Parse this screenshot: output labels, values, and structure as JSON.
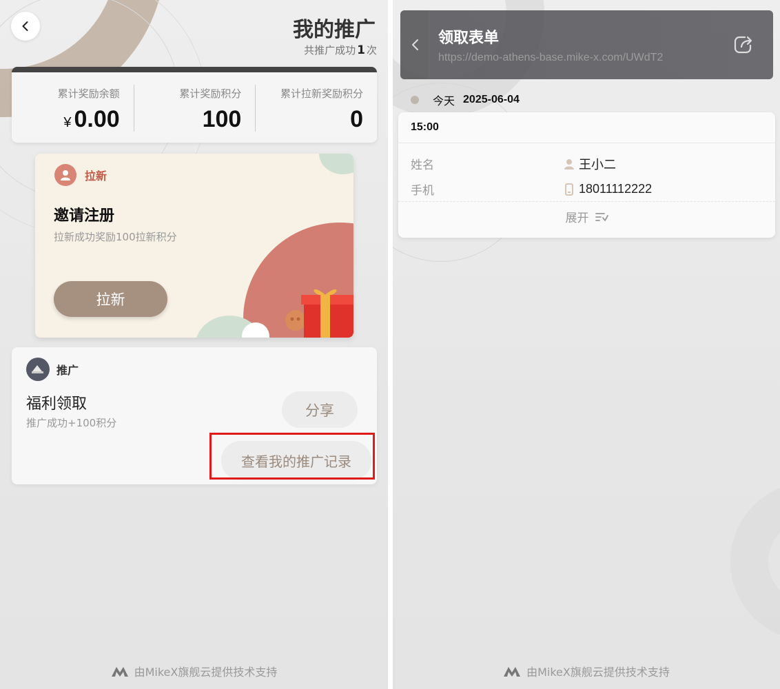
{
  "left": {
    "header": {
      "title": "我的推广",
      "count_prefix": "共推广成功",
      "count_value": "1",
      "count_suffix": "次"
    },
    "stats": [
      {
        "label": "累计奖励余额",
        "currency": "¥",
        "value": "0.00"
      },
      {
        "label": "累计奖励积分",
        "value": "100"
      },
      {
        "label": "累计拉新奖励积分",
        "value": "0"
      }
    ],
    "invite": {
      "badge": "拉新",
      "title": "邀请注册",
      "desc": "拉新成功奖励100拉新积分",
      "button": "拉新"
    },
    "promo": {
      "badge": "推广",
      "title": "福利领取",
      "desc": "推广成功+100积分",
      "share_button": "分享",
      "record_button": "查看我的推广记录"
    },
    "footer": "由MikeX旗舰云提供技术支持"
  },
  "right": {
    "header": {
      "title": "领取表单",
      "url": "https://demo-athens-base.mike-x.com/UWdT2"
    },
    "date": {
      "label": "今天",
      "value": "2025-06-04"
    },
    "record": {
      "time": "15:00",
      "fields": [
        {
          "key": "姓名",
          "value": "王小二",
          "icon": "user-icon"
        },
        {
          "key": "手机",
          "value": "18011112222",
          "icon": "phone-icon"
        }
      ],
      "expand": "展开"
    },
    "footer": "由MikeX旗舰云提供技术支持"
  },
  "colors": {
    "accent_brown": "#a69080",
    "invite_red": "#d37e72",
    "highlight_red": "#e01919",
    "header_dark": "#444444"
  }
}
